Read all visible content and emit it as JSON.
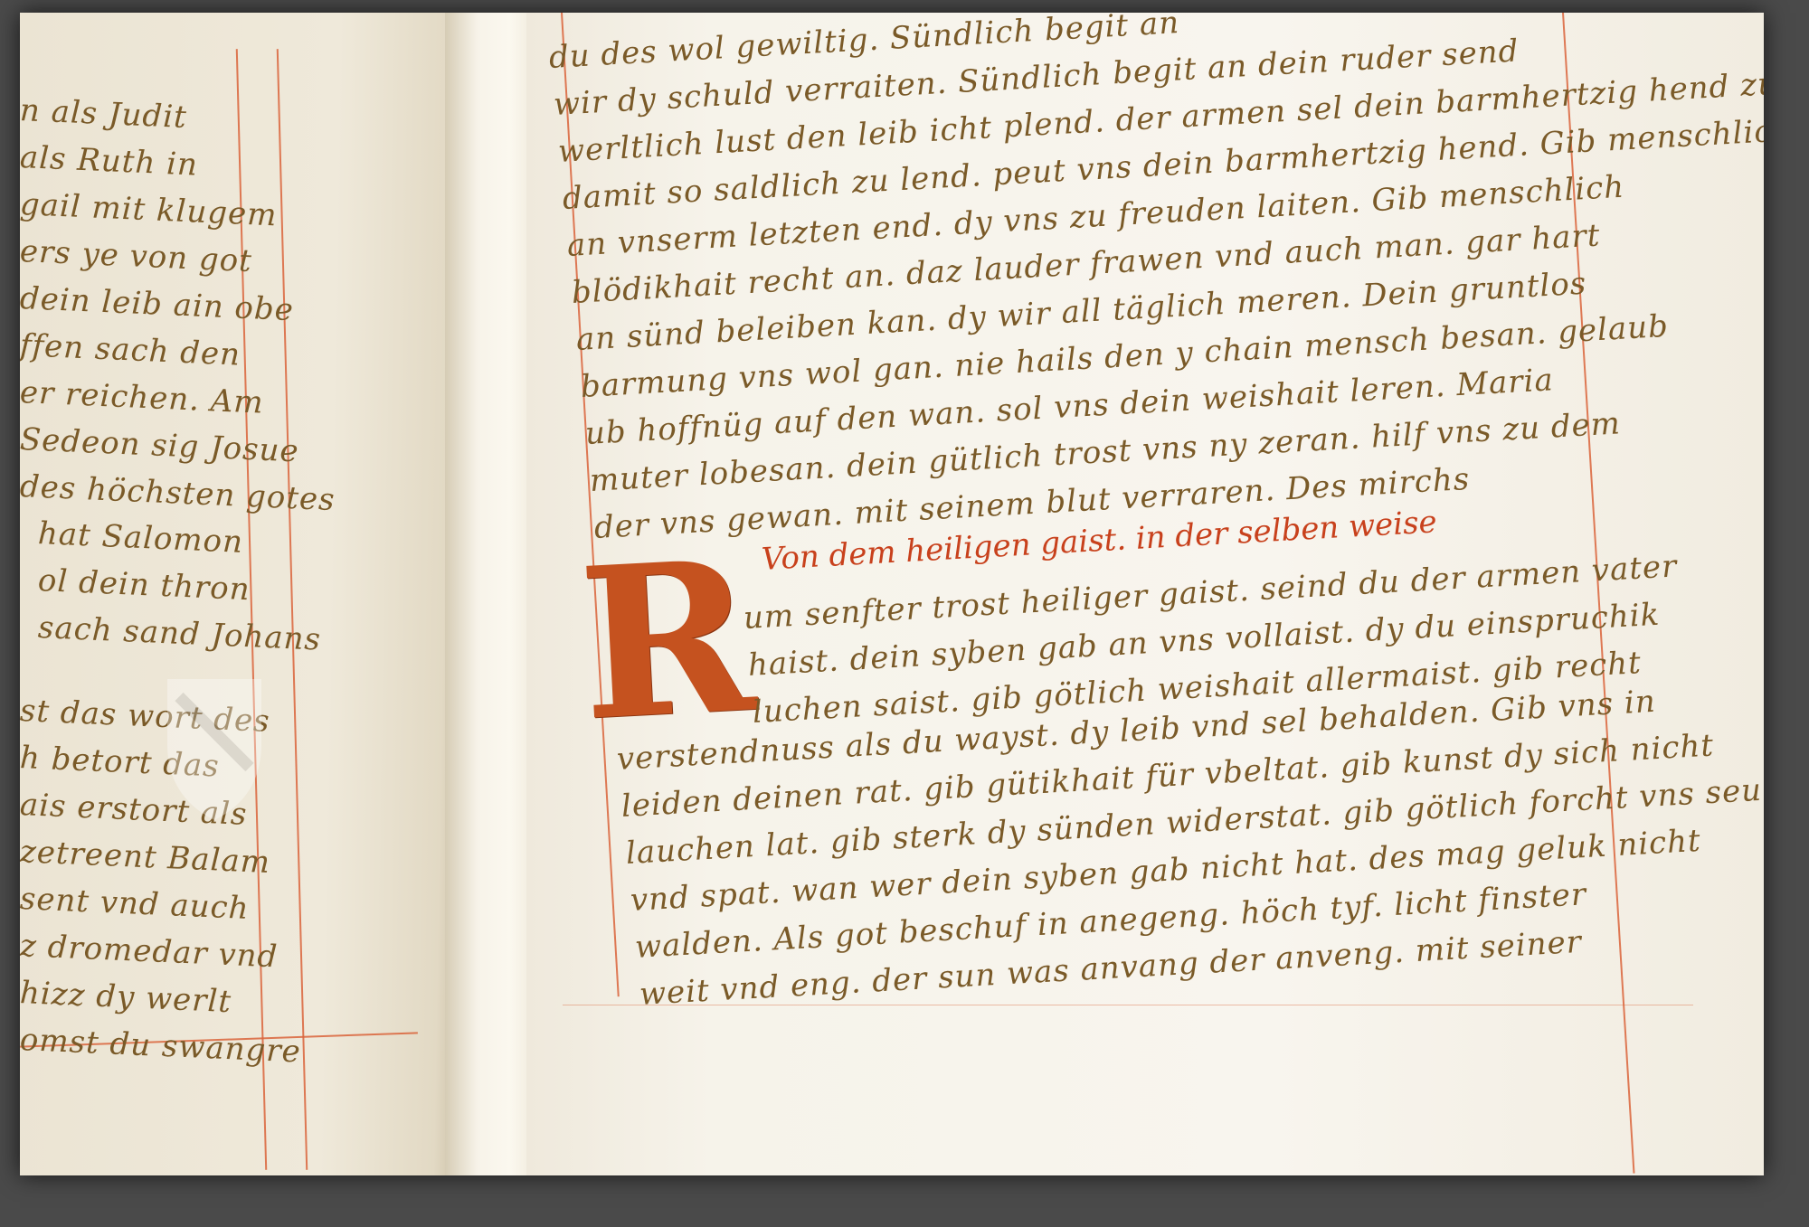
{
  "left_page": {
    "lines": [
      "n als Judit",
      "als Ruth in",
      "gail mit klugem",
      "ers ye von got",
      "dein leib ain obe",
      "ffen sach den",
      "er reichen. Am",
      "Sedeon sig Josue",
      "des höchsten gotes",
      "hat Salomon",
      "ol dein thron",
      "sach sand Johans",
      "st das wort des",
      "h betort das",
      "ais erstort als",
      "zetreent Balam",
      "sent vnd auch",
      "z dromedar vnd",
      "hizz dy werlt",
      "omst du swangre"
    ]
  },
  "right_page": {
    "lines": [
      "du des wol gewiltig. Sündlich begit an",
      "wir dy schuld verraiten. Sündlich begit an dein ruder send",
      "werltlich lust den leib icht plend. der armen sel dein barmhertzig hend zu trost",
      "damit so saldlich zu lend. peut vns dein barmhertzig hend. Gib menschlich",
      "an vnserm letzten end. dy vns zu freuden laiten. Gib menschlich",
      "blödikhait recht an. daz lauder frawen vnd auch man. gar hart",
      "an sünd beleiben kan. dy wir all täglich meren. Dein gruntlos",
      "barmung vns wol gan. nie hails den y chain mensch besan. gelaub",
      "ub hoffnüg auf den wan. sol vns dein weishait leren. Maria",
      "muter lobesan. dein gütlich trost vns ny zeran. hilf vns zu dem",
      "der vns gewan. mit seinem blut verraren. Des mirchs"
    ],
    "heading": "Von dem heiligen gaist. in der selben weise",
    "initial": "R",
    "lines2": [
      "um senfter trost heiliger gaist. seind du der armen vater",
      "haist. dein syben gab an vns vollaist. dy du einspruchik",
      "luchen saist. gib götlich weishait allermaist. gib recht",
      "verstendnuss als du wayst. dy leib vnd sel behalden. Gib vns in",
      "leiden deinen rat. gib gütikhait für vbeltat. gib kunst dy sich nicht",
      "lauchen lat. gib sterk dy sünden widerstat. gib götlich forcht vns seu",
      "vnd spat. wan wer dein syben gab nicht hat. des mag geluk nicht",
      "walden. Als got beschuf in anegeng. höch tyf. licht finster",
      "weit vnd eng. der sun was anvang der anveng. mit seiner"
    ]
  },
  "colors": {
    "ink": "#7a5a28",
    "rubric": "#c8411c",
    "initial": "#c5521f",
    "parchment": "#f3efe4",
    "frame": "#4a4a4a"
  }
}
